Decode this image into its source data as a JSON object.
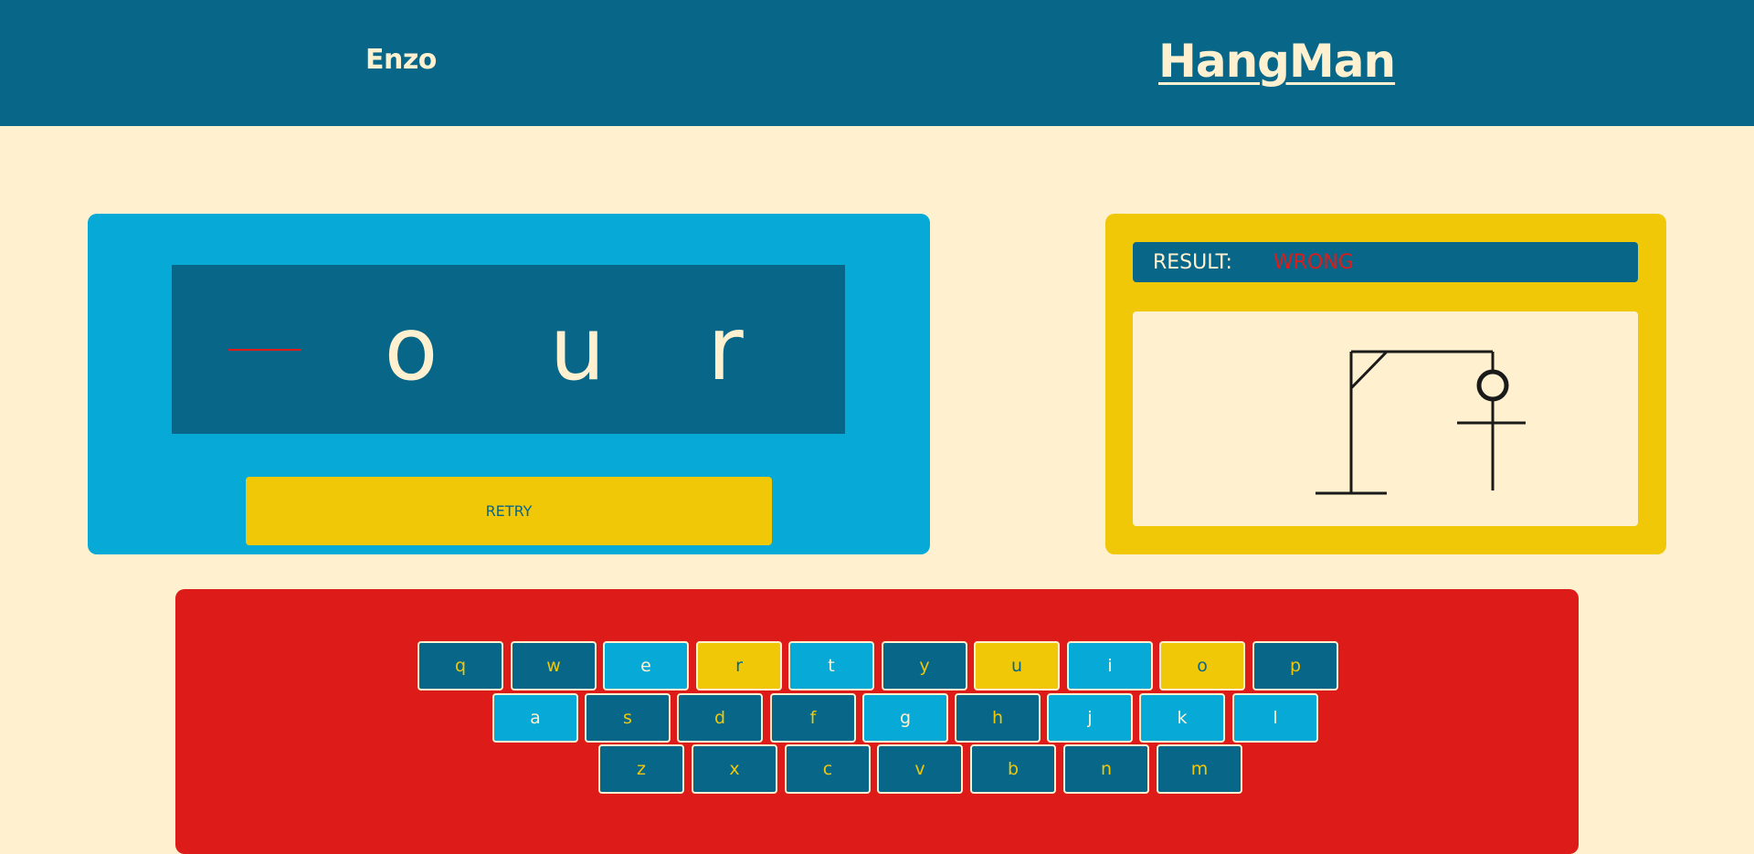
{
  "header": {
    "username": "Enzo",
    "title": "HangMan"
  },
  "word": {
    "letters": [
      "",
      "o",
      "u",
      "r"
    ]
  },
  "retry": {
    "label": "RETRY"
  },
  "result": {
    "label": "RESULT:",
    "value": "WRONG"
  },
  "keyboard": {
    "rows": [
      [
        {
          "key": "q",
          "state": "unused"
        },
        {
          "key": "w",
          "state": "unused"
        },
        {
          "key": "e",
          "state": "wrong"
        },
        {
          "key": "r",
          "state": "correct"
        },
        {
          "key": "t",
          "state": "wrong"
        },
        {
          "key": "y",
          "state": "unused"
        },
        {
          "key": "u",
          "state": "correct"
        },
        {
          "key": "i",
          "state": "wrong"
        },
        {
          "key": "o",
          "state": "correct"
        },
        {
          "key": "p",
          "state": "unused"
        }
      ],
      [
        {
          "key": "a",
          "state": "wrong"
        },
        {
          "key": "s",
          "state": "unused"
        },
        {
          "key": "d",
          "state": "unused"
        },
        {
          "key": "f",
          "state": "unused"
        },
        {
          "key": "g",
          "state": "wrong"
        },
        {
          "key": "h",
          "state": "unused"
        },
        {
          "key": "j",
          "state": "wrong"
        },
        {
          "key": "k",
          "state": "wrong"
        },
        {
          "key": "l",
          "state": "wrong"
        }
      ],
      [
        {
          "key": "z",
          "state": "unused"
        },
        {
          "key": "x",
          "state": "unused"
        },
        {
          "key": "c",
          "state": "unused"
        },
        {
          "key": "v",
          "state": "unused"
        },
        {
          "key": "b",
          "state": "unused"
        },
        {
          "key": "n",
          "state": "unused"
        },
        {
          "key": "m",
          "state": "unused"
        }
      ]
    ]
  },
  "colors": {
    "background": "#fff1d0",
    "primary": "#086788",
    "accent": "#07a9d6",
    "highlight": "#f0c808",
    "danger": "#dd1c1a"
  },
  "icons": {
    "gallows": "hangman-gallows-icon"
  }
}
